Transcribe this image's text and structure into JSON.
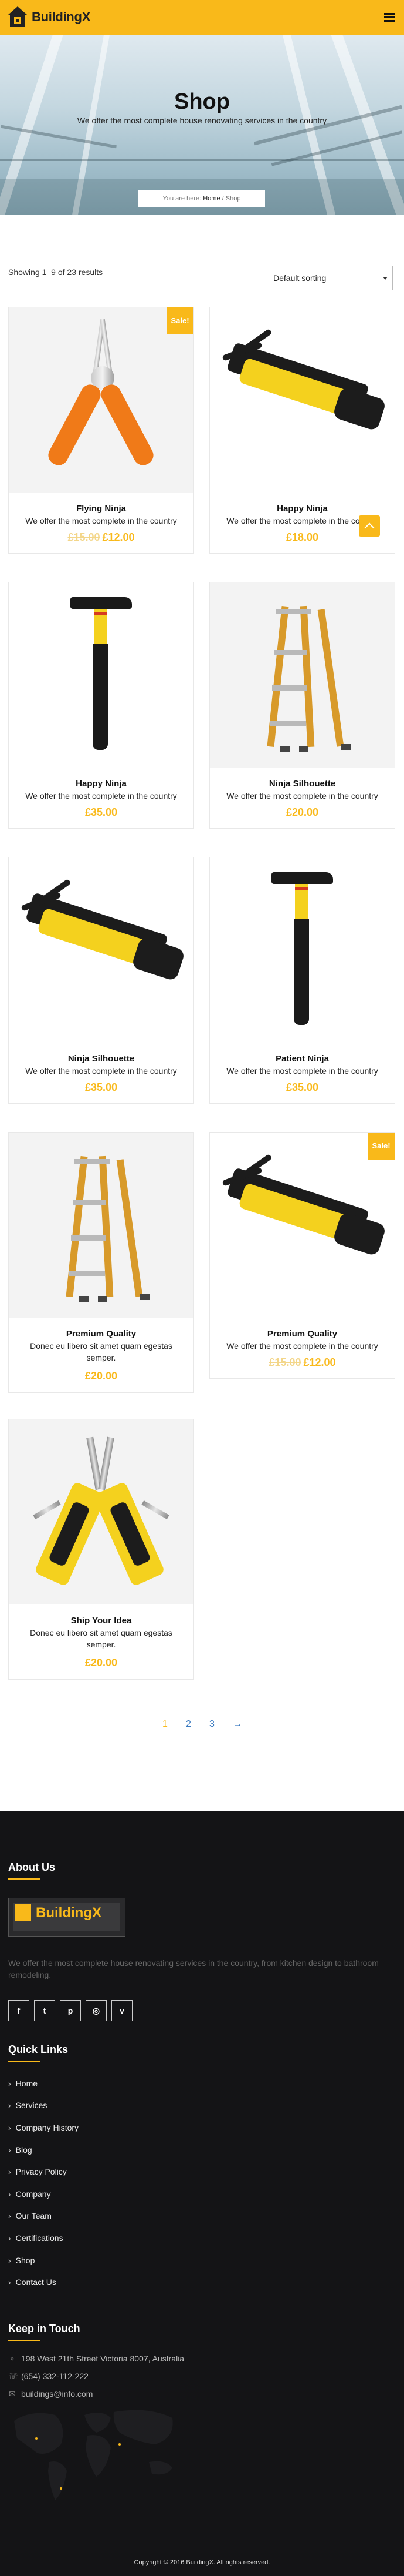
{
  "header": {
    "brand": "BuildingX"
  },
  "hero": {
    "title": "Shop",
    "subtitle": "We offer the most complete house renovating services in the country",
    "breadcrumb_prefix": "You are here:",
    "breadcrumb_home": "Home",
    "breadcrumb_sep": "/",
    "breadcrumb_current": "Shop"
  },
  "toolbar": {
    "result_count": "Showing 1–9 of 23 results",
    "sort_value": "Default sorting"
  },
  "products": [
    {
      "name": "Flying Ninja",
      "desc": "We offer the most complete in the country",
      "price_old": "£15.00",
      "price": "£12.00",
      "sale": "Sale!",
      "image": "pliers"
    },
    {
      "name": "Happy Ninja",
      "desc": "We offer the most complete in the country",
      "price": "£18.00",
      "image": "multitool-closed"
    },
    {
      "name": "Happy Ninja",
      "desc": "We offer the most complete in the country",
      "price": "£35.00",
      "image": "hammer"
    },
    {
      "name": "Ninja Silhouette",
      "desc": "We offer the most complete in the country",
      "price": "£20.00",
      "image": "ladder"
    },
    {
      "name": "Ninja Silhouette",
      "desc": "We offer the most complete in the country",
      "price": "£35.00",
      "image": "multitool-closed"
    },
    {
      "name": "Patient Ninja",
      "desc": "We offer the most complete in the country",
      "price": "£35.00",
      "image": "hammer"
    },
    {
      "name": "Premium Quality",
      "desc": "Donec eu libero sit amet quam egestas semper.",
      "price": "£20.00",
      "image": "ladder"
    },
    {
      "name": "Premium Quality",
      "desc": "We offer the most complete in the country",
      "price_old": "£15.00",
      "price": "£12.00",
      "sale": "Sale!",
      "image": "multitool-closed"
    },
    {
      "name": "Ship Your Idea",
      "desc": "Donec eu libero sit amet quam egestas semper.",
      "price": "£20.00",
      "image": "multitool-open"
    }
  ],
  "pagination": {
    "current": "1",
    "pages": [
      "2",
      "3"
    ],
    "next": "→"
  },
  "footer": {
    "about_heading": "About Us",
    "logo_text": "BuildingX",
    "about_text": "We offer the most complete house renovating services in the country, from kitchen design to bathroom remodeling.",
    "social": [
      {
        "icon": "facebook-icon",
        "glyph": "f"
      },
      {
        "icon": "twitter-icon",
        "glyph": "t"
      },
      {
        "icon": "pinterest-icon",
        "glyph": "p"
      },
      {
        "icon": "instagram-icon",
        "glyph": "◎"
      },
      {
        "icon": "vimeo-icon",
        "glyph": "v"
      }
    ],
    "links_heading": "Quick Links",
    "links": [
      "Home",
      "Services",
      "Company History",
      "Blog",
      "Privacy Policy",
      "Company",
      "Our Team",
      "Certifications",
      "Shop",
      "Contact Us"
    ],
    "touch_heading": "Keep in Touch",
    "address": "198 West 21th Street Victoria 8007, Australia",
    "phone": "(654) 332-112-222",
    "email": "buildings@info.com",
    "copyright": "Copyright © 2016 BuildingX. All rights reserved."
  },
  "colors": {
    "accent": "#f9b91a",
    "footer_bg": "#141416"
  }
}
